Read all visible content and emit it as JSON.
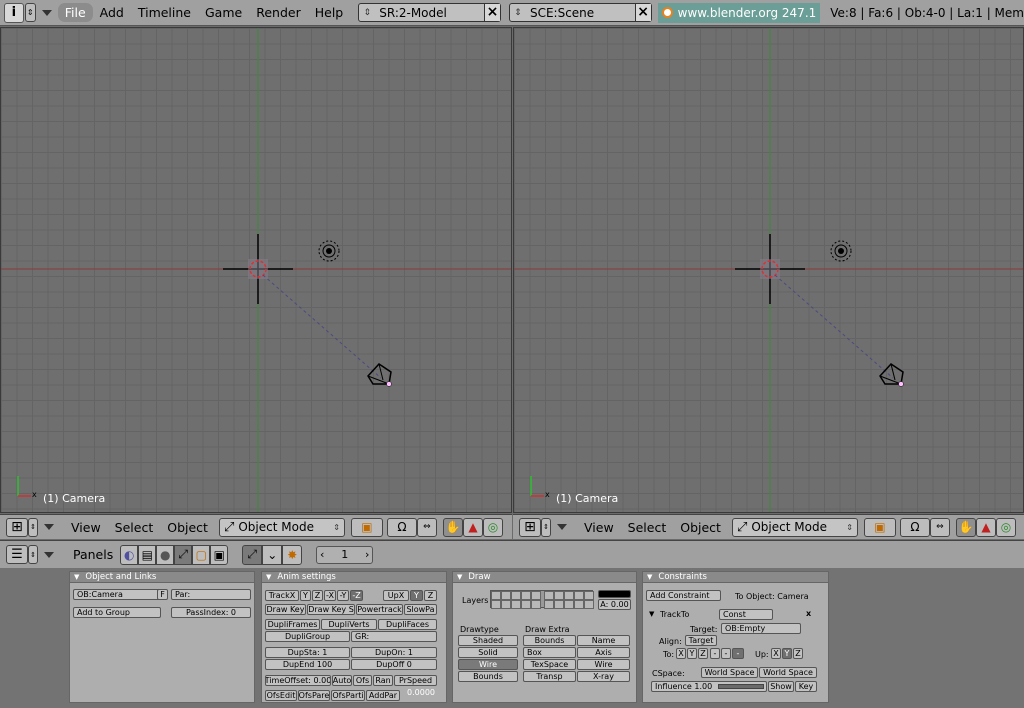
{
  "topbar": {
    "info_icon": "i",
    "menus": [
      "File",
      "Add",
      "Timeline",
      "Game",
      "Render",
      "Help"
    ],
    "screen": "SR:2-Model",
    "scene": "SCE:Scene",
    "url": "www.blender.org 247.1",
    "stats": "Ve:8 | Fa:6 | Ob:4-0 | La:1 | Mem"
  },
  "viewport": {
    "label": "(1) Camera"
  },
  "view_header": {
    "menus": [
      "View",
      "Select",
      "Object"
    ],
    "mode": "Object Mode"
  },
  "buttons_header": {
    "panels_label": "Panels",
    "frame": "1"
  },
  "panels": {
    "object_links": {
      "title": "Object and Links",
      "ob": "OB:Camera",
      "f": "F",
      "par": "Par:",
      "add_group": "Add to Group",
      "pass": "PassIndex: 0"
    },
    "anim": {
      "title": "Anim settings",
      "track": [
        "TrackX",
        "Y",
        "Z",
        "-X",
        "-Y",
        "-Z"
      ],
      "up": [
        "UpX",
        "Y",
        "Z"
      ],
      "row2": [
        "Draw Key",
        "Draw Key S",
        "Powertrack",
        "SlowPa"
      ],
      "row3": [
        "DupliFrames",
        "DupliVerts",
        "DupliFaces"
      ],
      "dupligroup": "DupliGroup",
      "gr": "GR:",
      "dupsta": "DupSta: 1",
      "dupon": "DupOn: 1",
      "dupend": "DupEnd 100",
      "dupoff": "DupOff 0",
      "row6": [
        "TimeOffset: 0.00",
        "Auto",
        "Ofs",
        "Ran",
        "PrSpeed"
      ],
      "row7": [
        "OfsEdit",
        "OfsPare",
        "OfsParti",
        "AddPar"
      ],
      "value": "0.0000"
    },
    "draw": {
      "title": "Draw",
      "layers_label": "Layers",
      "alpha": "A: 0.00",
      "drawtype_label": "Drawtype",
      "drawtypes": [
        "Shaded",
        "Solid",
        "Wire",
        "Bounds"
      ],
      "extra_label": "Draw Extra",
      "bounds": "Bounds",
      "box": "Box",
      "extras": [
        "Name",
        "Axis",
        "Wire",
        "X-ray"
      ],
      "texspace": "TexSpace",
      "transp": "Transp"
    },
    "constraints": {
      "title": "Constraints",
      "add": "Add Constraint",
      "to_object": "To Object: Camera",
      "trackto": "TrackTo",
      "const": "Const",
      "close": "x",
      "target_label": "Target:",
      "target": "OB:Empty",
      "align_label": "Align:",
      "align_btn": "Target",
      "to_label": "To:",
      "to_axes": [
        "X",
        "Y",
        "Z",
        "-",
        "-",
        "-"
      ],
      "up_label": "Up:",
      "up_axes": [
        "X",
        "Y",
        "Z"
      ],
      "cspace_label": "CSpace:",
      "cspace1": "World Space",
      "cspace2": "World Space",
      "influence": "Influence 1.00",
      "show": "Show",
      "key": "Key"
    }
  }
}
